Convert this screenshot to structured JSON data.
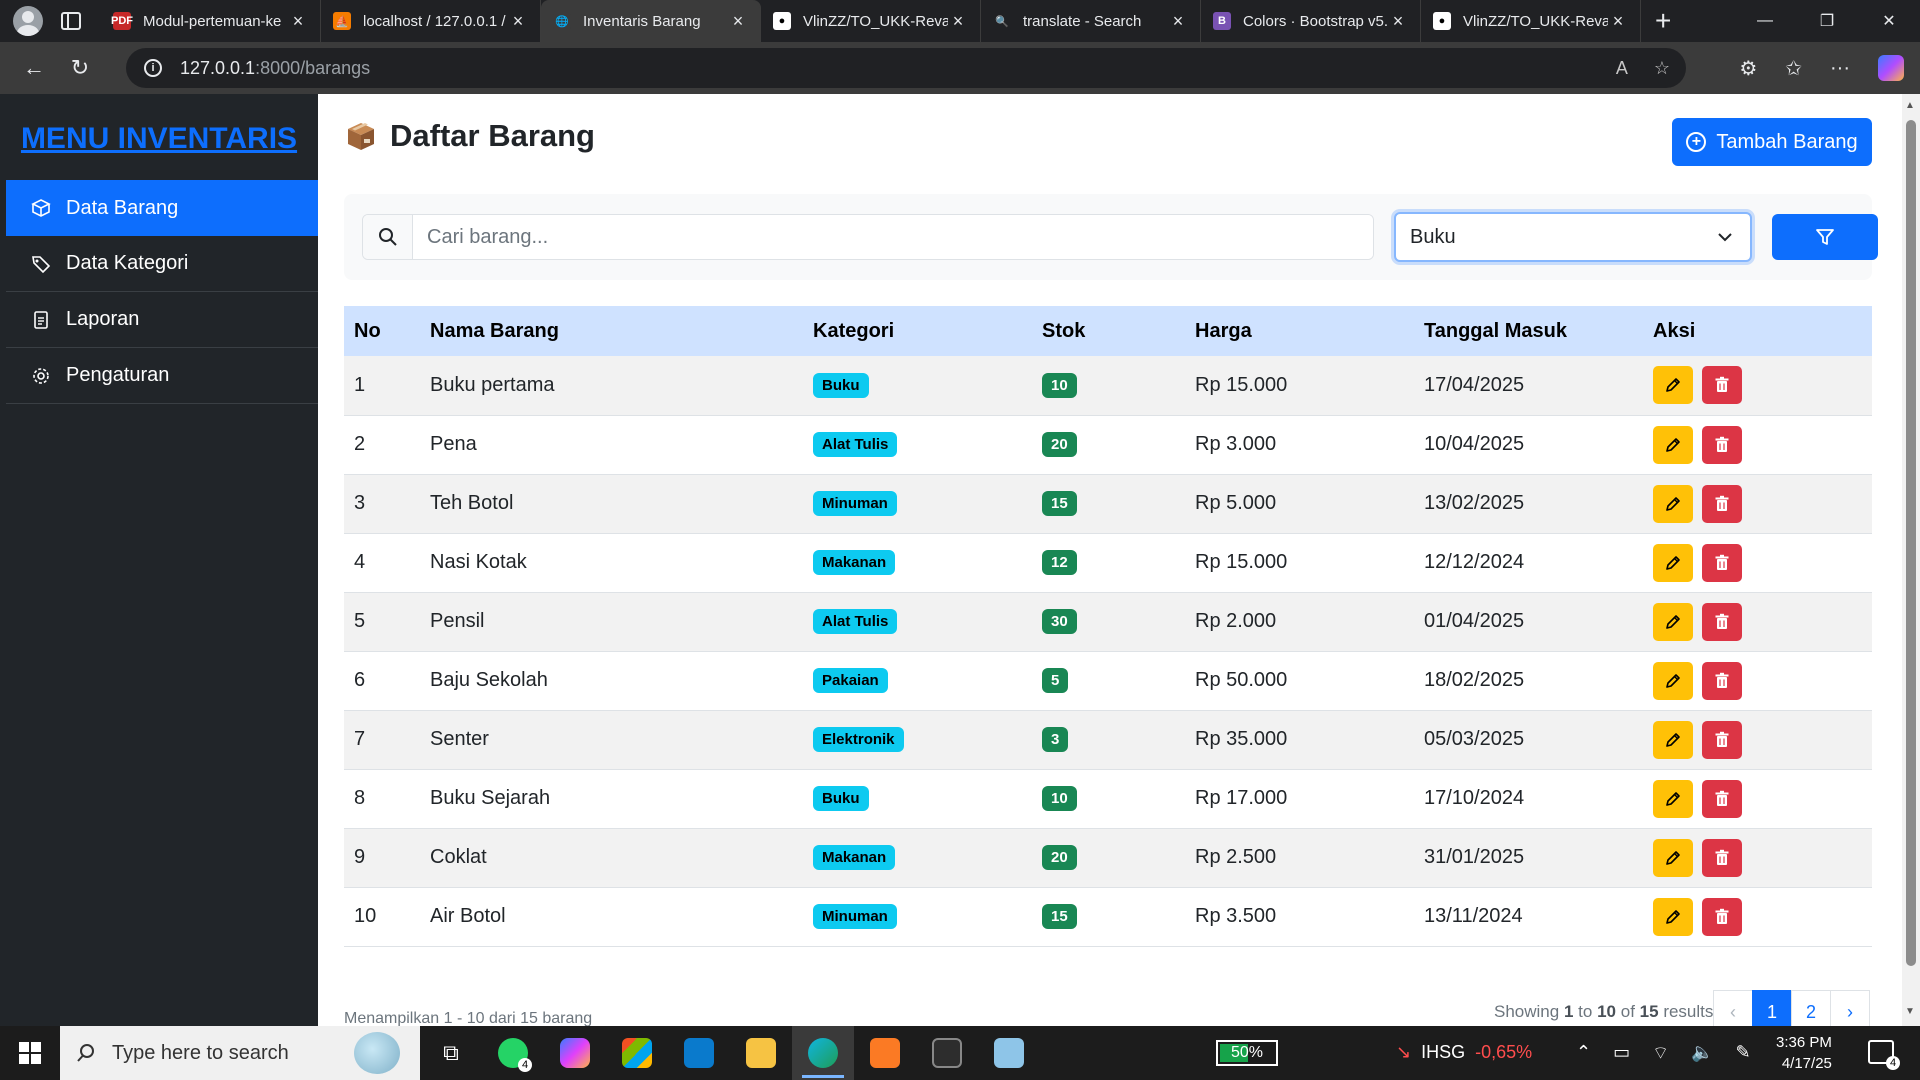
{
  "browser": {
    "tabs": [
      {
        "title": "Modul-pertemuan-ke",
        "fav_color": "#c62828",
        "fav_text": "PDF"
      },
      {
        "title": "localhost / 127.0.0.1 /",
        "fav_color": "#f57c00",
        "fav_text": "⛵"
      },
      {
        "title": "Inventaris Barang",
        "fav_color": "#3b3b3b",
        "fav_text": "🌐"
      },
      {
        "title": "VlinZZ/TO_UKK-Revali",
        "fav_color": "#ffffff",
        "fav_text": "●"
      },
      {
        "title": "translate - Search",
        "fav_color": "#202124",
        "fav_text": "🔍"
      },
      {
        "title": "Colors · Bootstrap v5.",
        "fav_color": "#7952b3",
        "fav_text": "B"
      },
      {
        "title": "VlinZZ/TO_UKK-Revali",
        "fav_color": "#ffffff",
        "fav_text": "●"
      }
    ],
    "active_tab": 2,
    "url_host": "127.0.0.1",
    "url_path": ":8000/barangs"
  },
  "sidebar": {
    "brand": "MENU INVENTARIS",
    "items": [
      {
        "label": "Data Barang",
        "icon": "box-icon",
        "active": true
      },
      {
        "label": "Data Kategori",
        "icon": "tags-icon",
        "active": false
      },
      {
        "label": "Laporan",
        "icon": "file-text-icon",
        "active": false
      },
      {
        "label": "Pengaturan",
        "icon": "gear-icon",
        "active": false
      }
    ]
  },
  "page": {
    "title": "Daftar Barang",
    "add_button": "Tambah Barang"
  },
  "filter": {
    "search_placeholder": "Cari barang...",
    "category_selected": "Buku"
  },
  "table": {
    "headers": [
      "No",
      "Nama Barang",
      "Kategori",
      "Stok",
      "Harga",
      "Tanggal Masuk",
      "Aksi"
    ],
    "rows": [
      {
        "no": "1",
        "nama": "Buku pertama",
        "kategori": "Buku",
        "stok": "10",
        "harga": "Rp 15.000",
        "tanggal": "17/04/2025"
      },
      {
        "no": "2",
        "nama": "Pena",
        "kategori": "Alat Tulis",
        "stok": "20",
        "harga": "Rp 3.000",
        "tanggal": "10/04/2025"
      },
      {
        "no": "3",
        "nama": "Teh Botol",
        "kategori": "Minuman",
        "stok": "15",
        "harga": "Rp 5.000",
        "tanggal": "13/02/2025"
      },
      {
        "no": "4",
        "nama": "Nasi Kotak",
        "kategori": "Makanan",
        "stok": "12",
        "harga": "Rp 15.000",
        "tanggal": "12/12/2024"
      },
      {
        "no": "5",
        "nama": "Pensil",
        "kategori": "Alat Tulis",
        "stok": "30",
        "harga": "Rp 2.000",
        "tanggal": "01/04/2025"
      },
      {
        "no": "6",
        "nama": "Baju Sekolah",
        "kategori": "Pakaian",
        "stok": "5",
        "harga": "Rp 50.000",
        "tanggal": "18/02/2025"
      },
      {
        "no": "7",
        "nama": "Senter",
        "kategori": "Elektronik",
        "stok": "3",
        "harga": "Rp 35.000",
        "tanggal": "05/03/2025"
      },
      {
        "no": "8",
        "nama": "Buku Sejarah",
        "kategori": "Buku",
        "stok": "10",
        "harga": "Rp 17.000",
        "tanggal": "17/10/2024"
      },
      {
        "no": "9",
        "nama": "Coklat",
        "kategori": "Makanan",
        "stok": "20",
        "harga": "Rp 2.500",
        "tanggal": "31/01/2025"
      },
      {
        "no": "10",
        "nama": "Air Botol",
        "kategori": "Minuman",
        "stok": "15",
        "harga": "Rp 3.500",
        "tanggal": "13/11/2024"
      }
    ]
  },
  "footer": {
    "info_left": "Menampilkan 1 - 10 dari 15 barang",
    "showing_prefix": "Showing",
    "showing_from": "1",
    "showing_to_word": "to",
    "showing_to": "10",
    "showing_of_word": "of",
    "showing_total": "15",
    "showing_suffix": "results",
    "pages": [
      "‹",
      "1",
      "2",
      "›"
    ],
    "current_page": "1"
  },
  "taskbar": {
    "search_placeholder": "Type here to search",
    "whatsapp_badge": "4",
    "battery": "50%",
    "ihsg_label": "IHSG",
    "ihsg_change": "-0,65%",
    "time": "3:36 PM",
    "date": "4/17/25",
    "notifications": "4"
  },
  "colors": {
    "primary": "#0d6efd",
    "sidebar_bg": "#212529",
    "badge_info": "#0dcaf0",
    "badge_success": "#198754",
    "warning": "#ffc107",
    "danger": "#dc3545",
    "thead_bg": "#cfe2ff"
  }
}
